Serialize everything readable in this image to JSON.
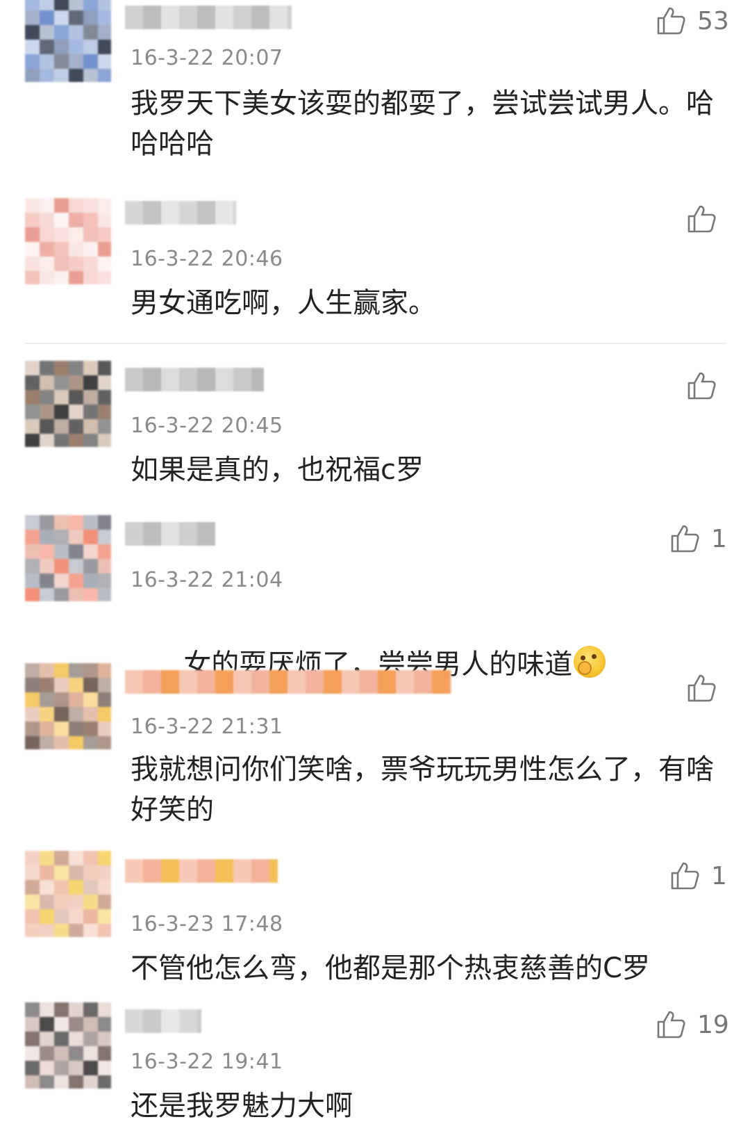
{
  "comments": [
    {
      "time": "16-3-22 20:07",
      "text": "我罗天下美女该耍的都耍了，尝试尝试男人。哈哈哈哈",
      "likes": "53",
      "avatar_colors": [
        "#5a7fc4",
        "#a5b8dc",
        "#1e2a3e",
        "#7c8fb0"
      ],
      "name_colors": [
        "#d0d0d0",
        "#bdbdbd",
        "#e2e2e2"
      ]
    },
    {
      "time": "16-3-22 20:46",
      "text": "男女通吃啊，人生赢家。",
      "likes": "",
      "avatar_colors": [
        "#f2b7ad",
        "#f6d4cf",
        "#fbeae7",
        "#e58d80"
      ],
      "name_colors": [
        "#d6d6d6",
        "#c4c4c4",
        "#e6e6e6"
      ]
    },
    {
      "time": "16-3-22 20:45",
      "text": "如果是真的，也祝福c罗",
      "likes": "",
      "avatar_colors": [
        "#8a6a55",
        "#1f1f1f",
        "#c9b3a0",
        "#3b3b3b"
      ],
      "name_colors": [
        "#c9c9c9",
        "#b8b8b8",
        "#dcdcdc"
      ]
    },
    {
      "time": "16-3-22 21:04",
      "text": "女的耍厌烦了，尝尝男人的味道",
      "likes": "1",
      "avatar_colors": [
        "#6f6f78",
        "#e8b4a5",
        "#f07c62",
        "#9aa1ad"
      ],
      "name_colors": [
        "#cfcfcf",
        "#bebebe",
        "#e0e0e0"
      ]
    },
    {
      "time": "16-3-22 21:31",
      "text": "我就想问你们笑啥，票爷玩玩男性怎么了，有啥好笑的",
      "likes": "",
      "avatar_colors": [
        "#8b6b58",
        "#d9a48a",
        "#f3c14b",
        "#5d4a40"
      ],
      "name_colors": [
        "#f6c8b4",
        "#f2b49c",
        "#f5a05a"
      ]
    },
    {
      "time": "16-3-23 17:48",
      "text": "不管他怎么弯，他都是那个热衷慈善的C罗",
      "likes": "1",
      "avatar_colors": [
        "#f2c7b4",
        "#e9ab8f",
        "#f4cf58",
        "#c99b86"
      ],
      "name_colors": [
        "#f7c9b5",
        "#f3b39a",
        "#f4c05a"
      ]
    },
    {
      "time": "16-3-22 19:41",
      "text": "还是我罗魅力大啊",
      "likes": "19",
      "avatar_colors": [
        "#6e5a55",
        "#c9b1a8",
        "#2e2a2a",
        "#e6d6d0"
      ],
      "name_colors": [
        "#d8d8d8",
        "#cacaca",
        "#e8e8e8"
      ]
    }
  ],
  "colors": {
    "text": "#222222",
    "time": "#8a8a8a",
    "icon": "#777777",
    "divider": "#eeeeee"
  },
  "icons": {
    "like": "thumbs-up-icon"
  }
}
